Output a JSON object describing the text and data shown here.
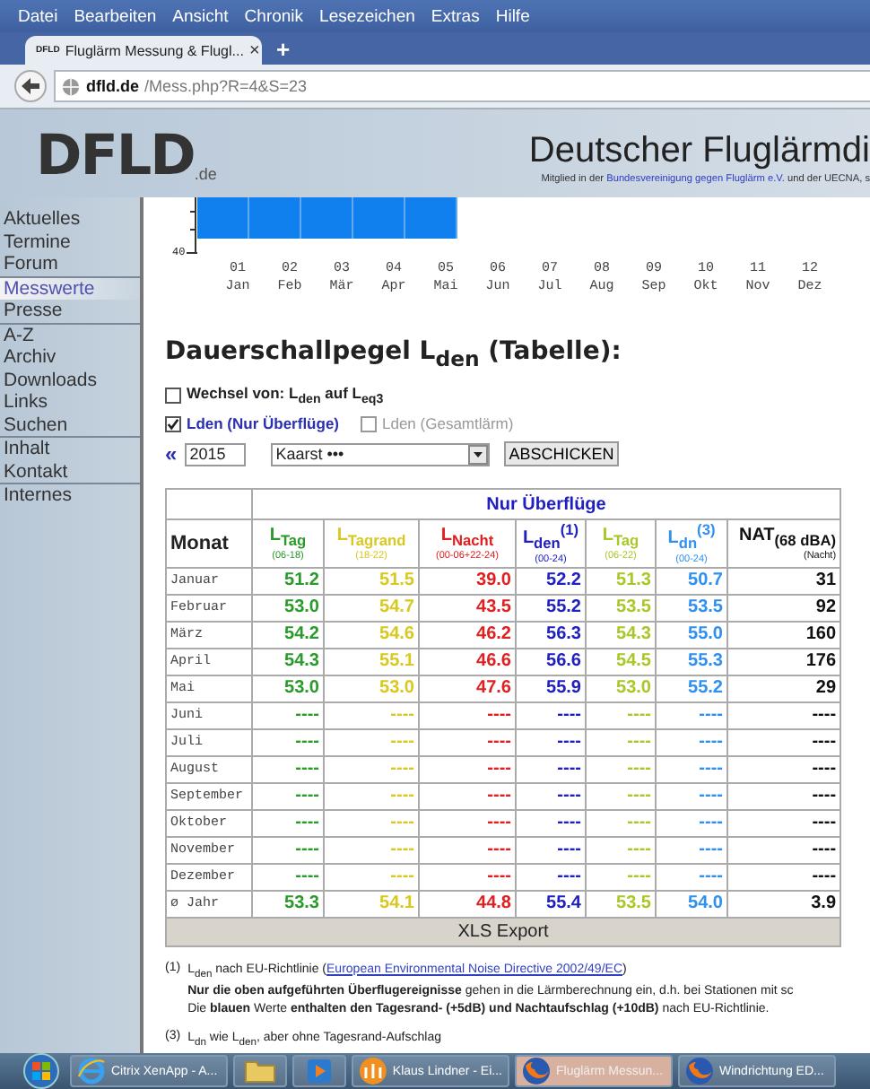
{
  "browser": {
    "menu": [
      "Datei",
      "Bearbeiten",
      "Ansicht",
      "Chronik",
      "Lesezeichen",
      "Extras",
      "Hilfe"
    ],
    "tab": {
      "favicon": "DFLD",
      "title": "Fluglärm Messung & Flugl...",
      "close": "×",
      "new": "+"
    },
    "address": {
      "domain": "dfld.de",
      "path": "/Mess.php?R=4&S=23"
    }
  },
  "header": {
    "logo": "DFLD",
    "logo_suffix": ".de",
    "title": "Deutscher Fluglärmdi",
    "subtitle_before": "Mitglied in der ",
    "subtitle_link": "Bundesvereinigung gegen Fluglärm e.V.",
    "subtitle_after": " und der UECNA, s"
  },
  "sidebar": {
    "groups": [
      [
        {
          "label": "Aktuelles",
          "selected": false
        },
        {
          "label": "Termine",
          "selected": false
        },
        {
          "label": "Forum",
          "selected": false
        }
      ],
      [
        {
          "label": "Messwerte",
          "selected": true
        },
        {
          "label": "Presse",
          "selected": false
        }
      ],
      [
        {
          "label": "A-Z",
          "selected": false
        },
        {
          "label": "Archiv",
          "selected": false
        },
        {
          "label": "Downloads",
          "selected": false
        },
        {
          "label": "Links",
          "selected": false
        },
        {
          "label": "Suchen",
          "selected": false
        }
      ],
      [
        {
          "label": "Inhalt",
          "selected": false
        },
        {
          "label": "Kontakt",
          "selected": false
        }
      ],
      [
        {
          "label": "Internes",
          "selected": false
        }
      ]
    ]
  },
  "chart": {
    "tick": "40",
    "months": [
      {
        "num": "01",
        "name": "Jan",
        "has_bar": true
      },
      {
        "num": "02",
        "name": "Feb",
        "has_bar": true
      },
      {
        "num": "03",
        "name": "Mär",
        "has_bar": true
      },
      {
        "num": "04",
        "name": "Apr",
        "has_bar": true
      },
      {
        "num": "05",
        "name": "Mai",
        "has_bar": true
      },
      {
        "num": "06",
        "name": "Jun",
        "has_bar": false
      },
      {
        "num": "07",
        "name": "Jul",
        "has_bar": false
      },
      {
        "num": "08",
        "name": "Aug",
        "has_bar": false
      },
      {
        "num": "09",
        "name": "Sep",
        "has_bar": false
      },
      {
        "num": "10",
        "name": "Okt",
        "has_bar": false
      },
      {
        "num": "11",
        "name": "Nov",
        "has_bar": false
      },
      {
        "num": "12",
        "name": "Dez",
        "has_bar": false
      }
    ]
  },
  "heading": "Dauerschallpegel L$_{den}$ (Tabelle):",
  "options": [
    {
      "label": "Wechsel von: L$_{den}$ auf L$_{eq3}$",
      "checked": false,
      "disabled": false
    },
    {
      "label": "Lden (Nur Überflüge)",
      "checked": true,
      "disabled": false
    },
    {
      "label": "Lden (Gesamtlärm)",
      "checked": false,
      "disabled": true
    }
  ],
  "controls": {
    "back": "«",
    "year": "2015",
    "station": "Kaarst •••",
    "submit": "ABSCHICKEN"
  },
  "table": {
    "group_header": "Nur Überflüge",
    "month_header": "Monat",
    "columns": [
      {
        "label": "L$_{Tag}$",
        "range": "(06-18)",
        "color": "#2a9a2a"
      },
      {
        "label": "L$_{Tagrand}$",
        "range": "(18-22)",
        "color": "#d8c820"
      },
      {
        "label": "L$_{Nacht}$",
        "range": "(00-06+22-24)",
        "color": "#e02020"
      },
      {
        "label": "L$_{den}$$^{(1)}$",
        "range": "(00-24)",
        "color": "#2020c0"
      },
      {
        "label": "L$_{Tag}$",
        "range": "(06-22)",
        "color": "#a8c828"
      },
      {
        "label": "L$_{dn}$$^{(3)}$",
        "range": "(00-24)",
        "color": "#3090f0"
      },
      {
        "label": "NAT$_{(68 dBA)}$",
        "range": "(Nacht)",
        "color": "#111111"
      }
    ],
    "rows": [
      {
        "month": "Januar",
        "values": [
          "51.2",
          "51.5",
          "39.0",
          "52.2",
          "51.3",
          "50.7",
          "31"
        ]
      },
      {
        "month": "Februar",
        "values": [
          "53.0",
          "54.7",
          "43.5",
          "55.2",
          "53.5",
          "53.5",
          "92"
        ]
      },
      {
        "month": "März",
        "values": [
          "54.2",
          "54.6",
          "46.2",
          "56.3",
          "54.3",
          "55.0",
          "160"
        ]
      },
      {
        "month": "April",
        "values": [
          "54.3",
          "55.1",
          "46.6",
          "56.6",
          "54.5",
          "55.3",
          "176"
        ]
      },
      {
        "month": "Mai",
        "values": [
          "53.0",
          "53.0",
          "47.6",
          "55.9",
          "53.0",
          "55.2",
          "29"
        ]
      },
      {
        "month": "Juni",
        "values": [
          "----",
          "----",
          "----",
          "----",
          "----",
          "----",
          "----"
        ]
      },
      {
        "month": "Juli",
        "values": [
          "----",
          "----",
          "----",
          "----",
          "----",
          "----",
          "----"
        ]
      },
      {
        "month": "August",
        "values": [
          "----",
          "----",
          "----",
          "----",
          "----",
          "----",
          "----"
        ]
      },
      {
        "month": "September",
        "values": [
          "----",
          "----",
          "----",
          "----",
          "----",
          "----",
          "----"
        ]
      },
      {
        "month": "Oktober",
        "values": [
          "----",
          "----",
          "----",
          "----",
          "----",
          "----",
          "----"
        ]
      },
      {
        "month": "November",
        "values": [
          "----",
          "----",
          "----",
          "----",
          "----",
          "----",
          "----"
        ]
      },
      {
        "month": "Dezember",
        "values": [
          "----",
          "----",
          "----",
          "----",
          "----",
          "----",
          "----"
        ]
      },
      {
        "month": "ø Jahr",
        "values": [
          "53.3",
          "54.1",
          "44.8",
          "55.4",
          "53.5",
          "54.0",
          "3.9"
        ]
      }
    ],
    "export": "XLS Export"
  },
  "notes": [
    {
      "mark": "(1)",
      "lines": [
        {
          "before": "L$_{den}$ nach EU-Richtlinie (",
          "link": "European Environmental Noise Directive 2002/49/EC",
          "after": ")"
        },
        {
          "text": "**Nur die oben aufgeführten Überflugereignisse** gehen in die Lärmberechnung ein, d.h. bei Stationen mit sc"
        },
        {
          "text": "Die **blauen** Werte **enthalten den Tagesrand- (+5dB) und Nachtaufschlag (+10dB)** nach EU-Richtlinie."
        }
      ]
    },
    {
      "mark": "(3)",
      "lines": [
        {
          "text": "L$_{dn}$ wie L$_{den}$, aber ohne Tagesrand-Aufschlag"
        }
      ]
    }
  ],
  "taskbar": [
    {
      "kind": "app",
      "label": "Citrix XenApp - A...",
      "selected": false
    },
    {
      "kind": "icon",
      "selected": false
    },
    {
      "kind": "icon",
      "selected": false
    },
    {
      "kind": "app",
      "label": "Klaus Lindner - Ei...",
      "selected": false
    },
    {
      "kind": "app",
      "label": "Fluglärm Messun...",
      "selected": true
    },
    {
      "kind": "app",
      "label": "Windrichtung ED...",
      "selected": false
    }
  ]
}
